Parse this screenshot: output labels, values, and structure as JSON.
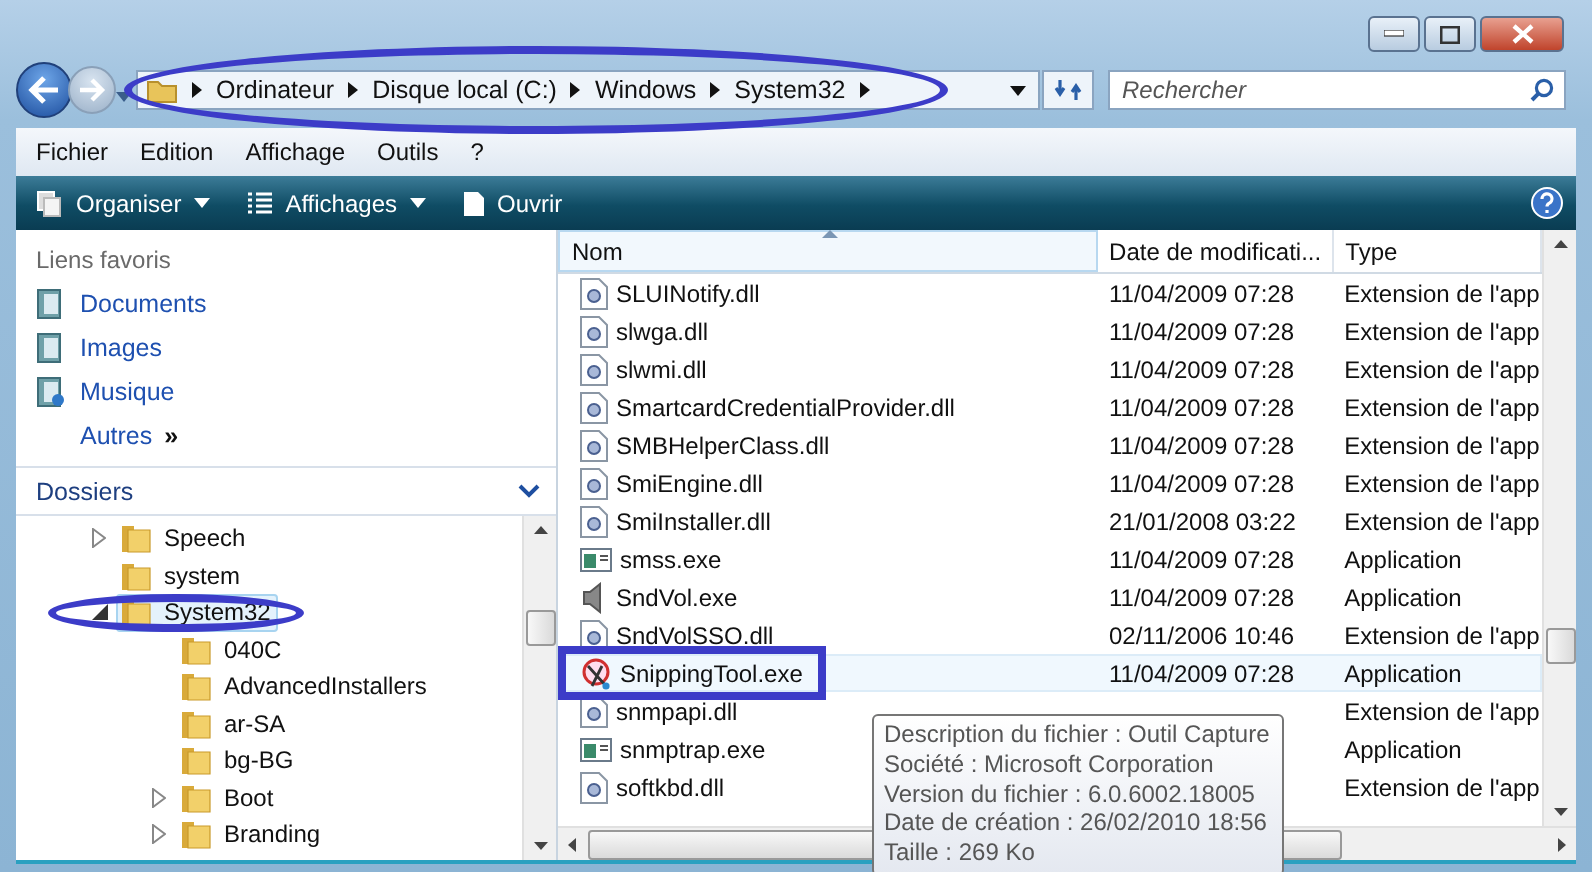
{
  "address": {
    "crumbs": [
      "Ordinateur",
      "Disque local (C:)",
      "Windows",
      "System32"
    ],
    "circled": true
  },
  "search": {
    "placeholder": "Rechercher"
  },
  "menu": [
    "Fichier",
    "Edition",
    "Affichage",
    "Outils",
    "?"
  ],
  "toolbar": [
    "Organiser",
    "Affichages",
    "Ouvrir"
  ],
  "favorites": {
    "title": "Liens favoris",
    "links": [
      "Documents",
      "Images",
      "Musique"
    ],
    "more": "Autres",
    "more_glyph": "»"
  },
  "folders": {
    "title": "Dossiers",
    "tree": [
      {
        "label": "Speech",
        "expandable": true,
        "expanded": false,
        "selected": false,
        "circled": false
      },
      {
        "label": "system",
        "expandable": false,
        "selected": false,
        "circled": false
      },
      {
        "label": "System32",
        "expandable": true,
        "expanded": true,
        "selected": true,
        "circled": true,
        "children": [
          {
            "label": "040C",
            "expandable": false,
            "selected": false,
            "circled": false
          },
          {
            "label": "AdvancedInstallers",
            "expandable": false,
            "selected": false,
            "circled": false
          },
          {
            "label": "ar-SA",
            "expandable": false,
            "selected": false,
            "circled": false
          },
          {
            "label": "bg-BG",
            "expandable": false,
            "selected": false,
            "circled": false
          },
          {
            "label": "Boot",
            "expandable": true,
            "expanded": false,
            "selected": false,
            "circled": false
          },
          {
            "label": "Branding",
            "expandable": true,
            "expanded": false,
            "selected": false,
            "circled": false
          }
        ]
      }
    ]
  },
  "table": {
    "columns": [
      "Nom",
      "Date de modificati...",
      "Type"
    ],
    "rows": [
      {
        "kind": "library",
        "name": "SLUINotify.dll",
        "date": "11/04/2009 07:28",
        "type": "Extension de l'app",
        "selected": false,
        "boxed": false
      },
      {
        "kind": "library",
        "name": "slwga.dll",
        "date": "11/04/2009 07:28",
        "type": "Extension de l'app",
        "selected": false,
        "boxed": false
      },
      {
        "kind": "library",
        "name": "slwmi.dll",
        "date": "11/04/2009 07:28",
        "type": "Extension de l'app",
        "selected": false,
        "boxed": false
      },
      {
        "kind": "library",
        "name": "SmartcardCredentialProvider.dll",
        "date": "11/04/2009 07:28",
        "type": "Extension de l'app",
        "selected": false,
        "boxed": false
      },
      {
        "kind": "library",
        "name": "SMBHelperClass.dll",
        "date": "11/04/2009 07:28",
        "type": "Extension de l'app",
        "selected": false,
        "boxed": false
      },
      {
        "kind": "library",
        "name": "SmiEngine.dll",
        "date": "11/04/2009 07:28",
        "type": "Extension de l'app",
        "selected": false,
        "boxed": false
      },
      {
        "kind": "library",
        "name": "SmiInstaller.dll",
        "date": "21/01/2008 03:22",
        "type": "Extension de l'app",
        "selected": false,
        "boxed": false
      },
      {
        "kind": "window",
        "name": "smss.exe",
        "date": "11/04/2009 07:28",
        "type": "Application",
        "selected": false,
        "boxed": false
      },
      {
        "kind": "speaker",
        "name": "SndVol.exe",
        "date": "11/04/2009 07:28",
        "type": "Application",
        "selected": false,
        "boxed": false
      },
      {
        "kind": "library",
        "name": "SndVolSSO.dll",
        "date": "02/11/2006 10:46",
        "type": "Extension de l'app",
        "selected": false,
        "boxed": false
      },
      {
        "kind": "scissors",
        "name": "SnippingTool.exe",
        "date": "11/04/2009 07:28",
        "type": "Application",
        "selected": true,
        "boxed": true
      },
      {
        "kind": "library",
        "name": "snmpapi.dll",
        "type": "Extension de l'app",
        "selected": false,
        "boxed": false
      },
      {
        "kind": "window",
        "name": "snmptrap.exe",
        "type": "Application",
        "selected": false,
        "boxed": false
      },
      {
        "kind": "library",
        "name": "softkbd.dll",
        "type": "Extension de l'app",
        "selected": false,
        "boxed": false
      }
    ]
  },
  "tooltip": [
    "Description du fichier : Outil Capture",
    "Société : Microsoft Corporation",
    "Version du fichier : 6.0.6002.18005",
    "Date de création : 26/02/2010 18:56",
    "Taille : 269 Ko"
  ]
}
